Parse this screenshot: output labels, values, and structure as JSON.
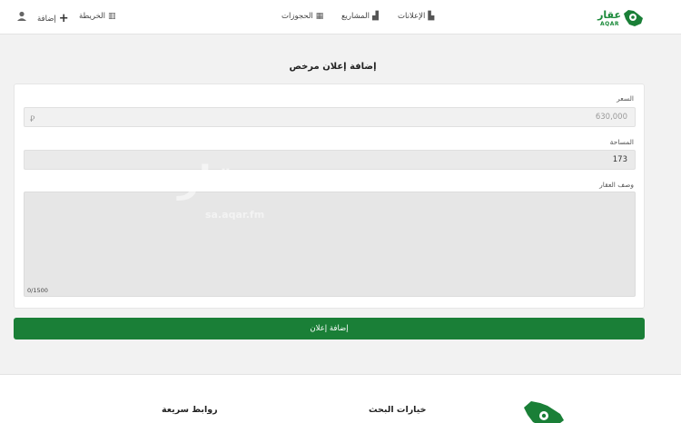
{
  "header": {
    "logo": {
      "arabic": "عقار",
      "english": "AQAR",
      "icon": "saudi-map-pin-logo"
    },
    "nav": [
      {
        "label": "الإعلانات",
        "icon": "building-icon"
      },
      {
        "label": "المشاريع",
        "icon": "projects-icon"
      },
      {
        "label": "الحجوزات",
        "icon": "calendar-icon"
      }
    ],
    "map_label": "الخريطة",
    "add_label": "إضافة",
    "user_icon": "user-icon"
  },
  "form": {
    "title": "إضافة إعلان مرخص",
    "price": {
      "label": "السعر",
      "value": "630,000",
      "currency_symbol": "⃁"
    },
    "area": {
      "label": "المساحة",
      "value": "173"
    },
    "description": {
      "label": "وصف العقار",
      "value": "",
      "counter": "0/1500"
    },
    "submit_label": "إضافة إعلان"
  },
  "watermark": {
    "arabic": "عقار",
    "english": "sa.aqar.fm"
  },
  "footer": {
    "search_options": "خيارات البحث",
    "quick_links": "روابط سريعة"
  },
  "colors": {
    "brand_green": "#1a7f37",
    "page_bg": "#f2f2f2"
  }
}
